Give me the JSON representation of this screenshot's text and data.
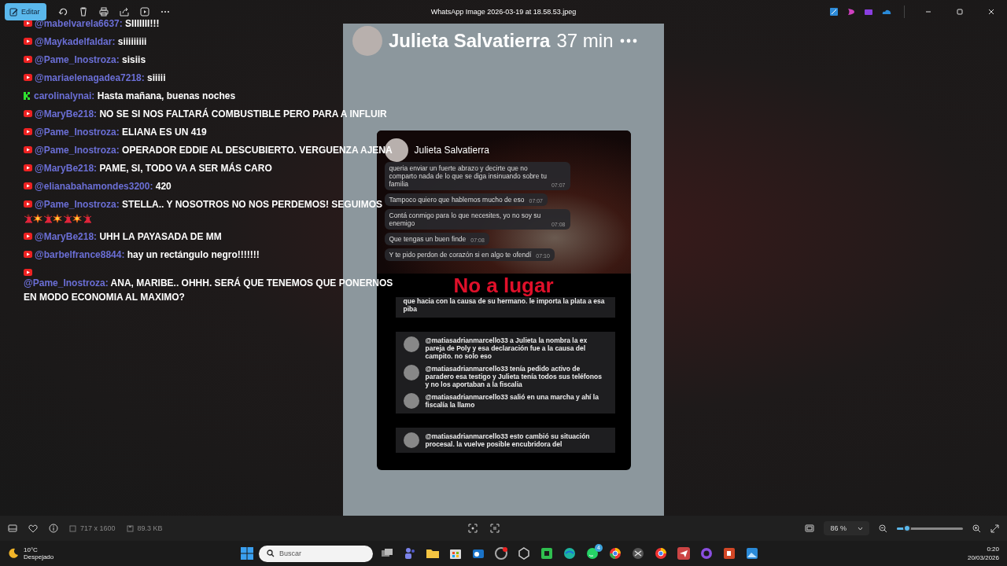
{
  "window": {
    "title": "WhatsApp Image 2026-03-19 at 18.58.53.jpeg",
    "edit_button": "Editar"
  },
  "chat": [
    {
      "kind": "youtube",
      "user": "@mabelvarela6637:",
      "text": "SIIIIIII!!!"
    },
    {
      "kind": "youtube",
      "user": "@Maykadelfaldar:",
      "text": "siiiiiiiii"
    },
    {
      "kind": "youtube",
      "user": "@Pame_Inostroza:",
      "text": "sisiis"
    },
    {
      "kind": "youtube",
      "user": "@mariaelenagadea7218:",
      "text": "siiiii"
    },
    {
      "kind": "kick",
      "user": "carolinalynai:",
      "text": "Hasta mañana, buenas noches"
    },
    {
      "kind": "youtube",
      "user": "@MaryBe218:",
      "text": "NO SE SI NOS FALTARÁ COMBUSTIBLE PERO PARA A INFLUIR"
    },
    {
      "kind": "youtube",
      "user": "@Pame_Inostroza:",
      "text": "ELIANA ES UN 419"
    },
    {
      "kind": "youtube",
      "user": "@Pame_Inostroza:",
      "text": "OPERADOR EDDIE AL DESCUBIERTO. VERGUENZA AJENA"
    },
    {
      "kind": "youtube",
      "user": "@MaryBe218:",
      "text": "PAME, SI, TODO VA A SER MÁS CARO"
    },
    {
      "kind": "youtube",
      "user": "@elianabahamondes3200:",
      "text": "420"
    },
    {
      "kind": "youtube",
      "user": "@Pame_Inostroza:",
      "text": "STELLA.. Y NOSOTROS NO NOS PERDEMOS! SEGUIMOS",
      "emojis": [
        {
          "kind": "dancer"
        },
        {
          "kind": "burst"
        },
        {
          "kind": "dancer"
        },
        {
          "kind": "burst"
        },
        {
          "kind": "dancer"
        },
        {
          "kind": "burst"
        },
        {
          "kind": "dancer"
        }
      ]
    },
    {
      "kind": "youtube",
      "user": "@MaryBe218:",
      "text": "UHH LA PAYASADA DE MM"
    },
    {
      "kind": "youtube",
      "user": "@barbelfrance8844:",
      "text": "hay un rectángulo negro!!!!!!!"
    },
    {
      "kind": "youtube",
      "user": "@Pame_Inostroza:",
      "text": "ANA, MARIBE.. OHHH. SERÁ QUE TENEMOS QUE PONERNOS EN MODO ECONOMIA AL MAXIMO?"
    }
  ],
  "story": {
    "name": "Julieta Salvatierra",
    "time": "37 min",
    "card": {
      "name": "Julieta Salvatierra",
      "messages": [
        {
          "text": "queria enviar un fuerte abrazo y decirte que no comparto nada de lo que se diga insinuando sobre tu familia",
          "time": "07:07"
        },
        {
          "text": "Tampoco quiero que hablemos mucho de eso",
          "time": "07:07"
        },
        {
          "text": "Contá conmigo para lo que necesites, yo no soy su enemigo",
          "time": "07:08"
        },
        {
          "text": "Que tengas un buen finde",
          "time": "07:08"
        },
        {
          "text": "Y te pido perdon de corazón si en algo te ofendí",
          "time": "07:10"
        }
      ],
      "banner": "No a lugar",
      "comment_groups": [
        [
          {
            "text": "que hacia con la causa de su hermano. le importa la plata a esa piba"
          }
        ],
        [
          {
            "user": "@matiasadrianmarcello33",
            "text": "a Julieta la nombra la ex pareja de Poly y esa declaración fue a la causa del campito. no solo eso"
          },
          {
            "user": "@matiasadrianmarcello33",
            "text": "tenía pedido activo de paradero esa testigo y Julieta tenía todos sus teléfonos y no los aportaban a la fiscalia"
          },
          {
            "user": "@matiasadrianmarcello33",
            "text": "salió en una marcha y ahí la fiscalía la llamo"
          }
        ],
        [
          {
            "user": "@matiasadrianmarcello33",
            "text": "esto cambió su situación procesal. la vuelve posible encubridora del"
          }
        ]
      ]
    }
  },
  "bottom_bar": {
    "dimensions": "717 x 1600",
    "file_size": "89.3 KB",
    "zoom": "86 %",
    "zoom_slider": {
      "level": 0.15
    }
  },
  "taskbar": {
    "temperature": "10°C",
    "weather": "Despejado",
    "search_placeholder": "Buscar",
    "whatsapp_badge": "4",
    "time": "0:20",
    "date": "20/03/2026"
  }
}
